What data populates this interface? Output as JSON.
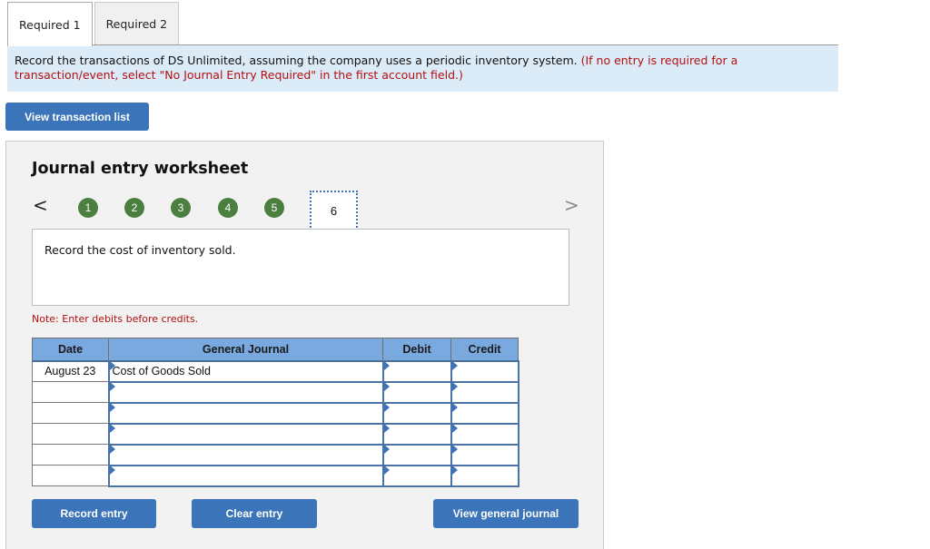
{
  "tabs": [
    {
      "label": "Required 1",
      "active": true
    },
    {
      "label": "Required 2",
      "active": false
    }
  ],
  "banner": {
    "instruction": "Record the transactions of DS Unlimited, assuming the company uses a periodic inventory system. ",
    "hint": "(If no entry is required for a transaction/event, select \"No Journal Entry Required\" in the first account field.)"
  },
  "buttons": {
    "view_transaction_list": "View transaction list",
    "record_entry": "Record entry",
    "clear_entry": "Clear entry",
    "view_general_journal": "View general journal"
  },
  "worksheet": {
    "title": "Journal entry worksheet",
    "nav": {
      "prev_icon": "<",
      "next_icon": ">"
    },
    "steps": [
      "1",
      "2",
      "3",
      "4",
      "5",
      "6"
    ],
    "current_step": "6",
    "completed_steps": [
      "1",
      "2",
      "3",
      "4",
      "5"
    ],
    "description": "Record the cost of inventory sold.",
    "note": "Note: Enter debits before credits."
  },
  "journal": {
    "headers": {
      "date": "Date",
      "general_journal": "General Journal",
      "debit": "Debit",
      "credit": "Credit"
    },
    "rows": [
      {
        "date": "August 23",
        "account": "Cost of Goods Sold",
        "debit": "",
        "credit": ""
      },
      {
        "date": "",
        "account": "",
        "debit": "",
        "credit": ""
      },
      {
        "date": "",
        "account": "",
        "debit": "",
        "credit": ""
      },
      {
        "date": "",
        "account": "",
        "debit": "",
        "credit": ""
      },
      {
        "date": "",
        "account": "",
        "debit": "",
        "credit": ""
      },
      {
        "date": "",
        "account": "",
        "debit": "",
        "credit": ""
      }
    ]
  },
  "colors": {
    "primary_button": "#3b74b8",
    "step_complete": "#4a7f3f",
    "banner_bg": "#dcebf8",
    "header_bg": "#7aa9df",
    "hint_red": "#b30f0f"
  }
}
